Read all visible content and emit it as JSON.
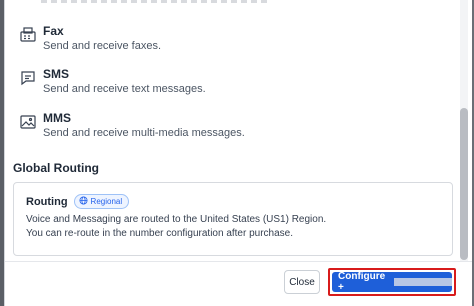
{
  "channels": [
    {
      "name": "Fax",
      "description": "Send and receive faxes.",
      "icon": "fax-icon"
    },
    {
      "name": "SMS",
      "description": "Send and receive text messages.",
      "icon": "chat-bubble-icon"
    },
    {
      "name": "MMS",
      "description": "Send and receive multi-media messages.",
      "icon": "image-icon"
    }
  ],
  "global_routing": {
    "title": "Global Routing",
    "routing_label": "Routing",
    "badge": "Regional",
    "line1": "Voice and Messaging are routed to the United States (US1) Region.",
    "line2": "You can re-route in the number configuration after purchase."
  },
  "footer": {
    "close_label": "Close",
    "configure_label": "Configure +"
  },
  "colors": {
    "primary": "#1e5fd9",
    "highlight": "#d81b1b",
    "badge": "#2563eb"
  }
}
